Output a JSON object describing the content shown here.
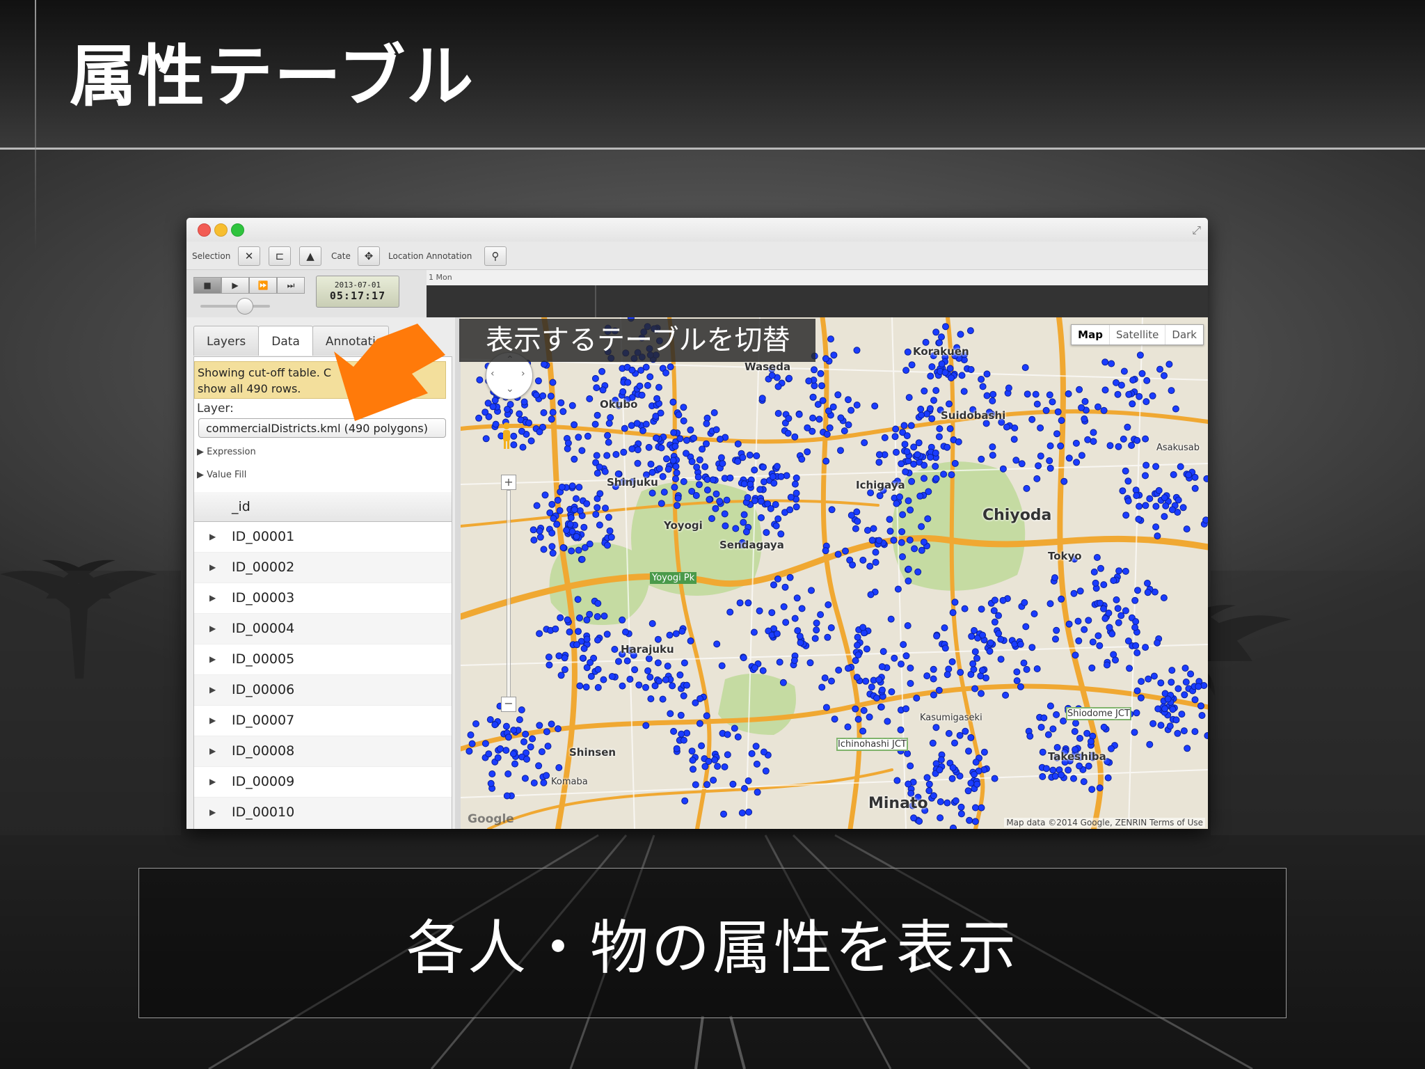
{
  "slide": {
    "title": "属性テーブル",
    "caption": "各人・物の属性を表示",
    "annotation": "表示するテーブルを切替"
  },
  "toolbar": {
    "selection_label": "Selection",
    "cate_label": "Cate",
    "location_annotation_label": "Location Annotation"
  },
  "timebar": {
    "date": "2013-07-01",
    "time": "05:17:17",
    "scale_label": "1 Mon"
  },
  "panel": {
    "tabs": [
      {
        "label": "Layers"
      },
      {
        "label": "Data"
      },
      {
        "label": "Annotati"
      }
    ],
    "notice_line1": "Showing cut-off table. C",
    "notice_line2": "show all 490 rows.",
    "layer_label": "Layer:",
    "layer_value": "commercialDistricts.kml (490 polygons)",
    "expression_label": "Expression",
    "value_fill_label": "Value Fill",
    "table": {
      "column": "_id",
      "rows": [
        "ID_00001",
        "ID_00002",
        "ID_00003",
        "ID_00004",
        "ID_00005",
        "ID_00006",
        "ID_00007",
        "ID_00008",
        "ID_00009",
        "ID_00010"
      ]
    }
  },
  "map": {
    "types": [
      "Map",
      "Satellite",
      "Dark"
    ],
    "active_type": "Map",
    "attribution": "Map data ©2014 Google, ZENRIN  Terms of Use",
    "google": "Google",
    "labels": {
      "korakuen": "Korakuen",
      "chiyoda": "Chiyoda",
      "shinjuku": "Shinjuku",
      "sendagaya": "Sendagaya",
      "yoyogi": "Yoyogi",
      "harajuku": "Harajuku",
      "tokyo": "Tokyo",
      "takeshiba": "Takeshiba",
      "shinsen": "Shinsen",
      "minato": "Minato",
      "okubo": "Okubo",
      "ichigaya": "Ichigaya",
      "kasumigaseki": "Kasumigaseki",
      "waseda": "Waseda",
      "yoyogi_park": "Yoyogi Pk",
      "shibuya": "Komaba",
      "suidobashi": "Suidobashi",
      "asakusabashi": "Asakusab",
      "shiodome": "Shiodome JCT",
      "ichinohashi": "Ichinohashi JCT"
    }
  },
  "colors": {
    "marker": "#1a3cff",
    "road": "#f0a832",
    "park": "#c5dba2",
    "arrow": "#ff7a0a"
  }
}
